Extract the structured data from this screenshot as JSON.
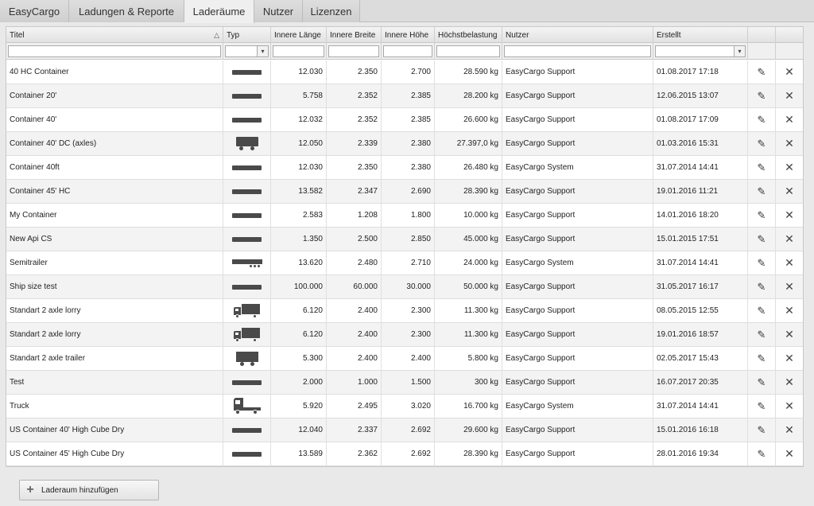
{
  "tabs": [
    {
      "label": "EasyCargo",
      "active": false
    },
    {
      "label": "Ladungen & Reporte",
      "active": false
    },
    {
      "label": "Laderäume",
      "active": true
    },
    {
      "label": "Nutzer",
      "active": false
    },
    {
      "label": "Lizenzen",
      "active": false
    }
  ],
  "columns": [
    "Titel",
    "Typ",
    "Innere Länge",
    "Innere Breite",
    "Innere Höhe",
    "Höchstbelastung",
    "Nutzer",
    "Erstellt",
    "",
    ""
  ],
  "rows": [
    {
      "title": "40 HC Container",
      "type": "container",
      "length": "12.030",
      "width": "2.350",
      "height": "2.700",
      "maxload": "28.590 kg",
      "user": "EasyCargo Support",
      "created": "01.08.2017 17:18"
    },
    {
      "title": "Container 20'",
      "type": "container",
      "length": "5.758",
      "width": "2.352",
      "height": "2.385",
      "maxload": "28.200 kg",
      "user": "EasyCargo Support",
      "created": "12.06.2015 13:07"
    },
    {
      "title": "Container 40'",
      "type": "container",
      "length": "12.032",
      "width": "2.352",
      "height": "2.385",
      "maxload": "26.600 kg",
      "user": "EasyCargo Support",
      "created": "01.08.2017 17:09"
    },
    {
      "title": "Container 40' DC (axles)",
      "type": "axles",
      "length": "12.050",
      "width": "2.339",
      "height": "2.380",
      "maxload": "27.397,0 kg",
      "user": "EasyCargo Support",
      "created": "01.03.2016 15:31"
    },
    {
      "title": "Container 40ft",
      "type": "container",
      "length": "12.030",
      "width": "2.350",
      "height": "2.380",
      "maxload": "26.480 kg",
      "user": "EasyCargo System",
      "created": "31.07.2014 14:41"
    },
    {
      "title": "Container 45' HC",
      "type": "container",
      "length": "13.582",
      "width": "2.347",
      "height": "2.690",
      "maxload": "28.390 kg",
      "user": "EasyCargo Support",
      "created": "19.01.2016 11:21"
    },
    {
      "title": "My Container",
      "type": "container",
      "length": "2.583",
      "width": "1.208",
      "height": "1.800",
      "maxload": "10.000 kg",
      "user": "EasyCargo Support",
      "created": "14.01.2016 18:20"
    },
    {
      "title": "New Api CS",
      "type": "container",
      "length": "1.350",
      "width": "2.500",
      "height": "2.850",
      "maxload": "45.000 kg",
      "user": "EasyCargo Support",
      "created": "15.01.2015 17:51"
    },
    {
      "title": "Semitrailer",
      "type": "semitrailer",
      "length": "13.620",
      "width": "2.480",
      "height": "2.710",
      "maxload": "24.000 kg",
      "user": "EasyCargo System",
      "created": "31.07.2014 14:41"
    },
    {
      "title": "Ship size test",
      "type": "container",
      "length": "100.000",
      "width": "60.000",
      "height": "30.000",
      "maxload": "50.000 kg",
      "user": "EasyCargo Support",
      "created": "31.05.2017 16:17"
    },
    {
      "title": "Standart 2 axle lorry",
      "type": "lorry",
      "length": "6.120",
      "width": "2.400",
      "height": "2.300",
      "maxload": "11.300 kg",
      "user": "EasyCargo Support",
      "created": "08.05.2015 12:55"
    },
    {
      "title": "Standart 2 axle lorry",
      "type": "lorry",
      "length": "6.120",
      "width": "2.400",
      "height": "2.300",
      "maxload": "11.300 kg",
      "user": "EasyCargo Support",
      "created": "19.01.2016 18:57"
    },
    {
      "title": "Standart 2 axle trailer",
      "type": "trailer",
      "length": "5.300",
      "width": "2.400",
      "height": "2.400",
      "maxload": "5.800 kg",
      "user": "EasyCargo Support",
      "created": "02.05.2017 15:43"
    },
    {
      "title": "Test",
      "type": "container",
      "length": "2.000",
      "width": "1.000",
      "height": "1.500",
      "maxload": "300 kg",
      "user": "EasyCargo Support",
      "created": "16.07.2017 20:35"
    },
    {
      "title": "Truck",
      "type": "truck",
      "length": "5.920",
      "width": "2.495",
      "height": "3.020",
      "maxload": "16.700 kg",
      "user": "EasyCargo System",
      "created": "31.07.2014 14:41"
    },
    {
      "title": "US Container 40' High Cube Dry",
      "type": "container",
      "length": "12.040",
      "width": "2.337",
      "height": "2.692",
      "maxload": "29.600 kg",
      "user": "EasyCargo Support",
      "created": "15.01.2016 16:18"
    },
    {
      "title": "US Container 45' High Cube Dry",
      "type": "container",
      "length": "13.589",
      "width": "2.362",
      "height": "2.692",
      "maxload": "28.390 kg",
      "user": "EasyCargo Support",
      "created": "28.01.2016 19:34"
    }
  ],
  "add_button_label": "Laderaum hinzufügen",
  "icons": {
    "sort": "sort-up-icon",
    "edit": "pencil-icon",
    "delete": "close-icon",
    "add": "plus-icon",
    "dropdown": "chevron-down-icon"
  }
}
